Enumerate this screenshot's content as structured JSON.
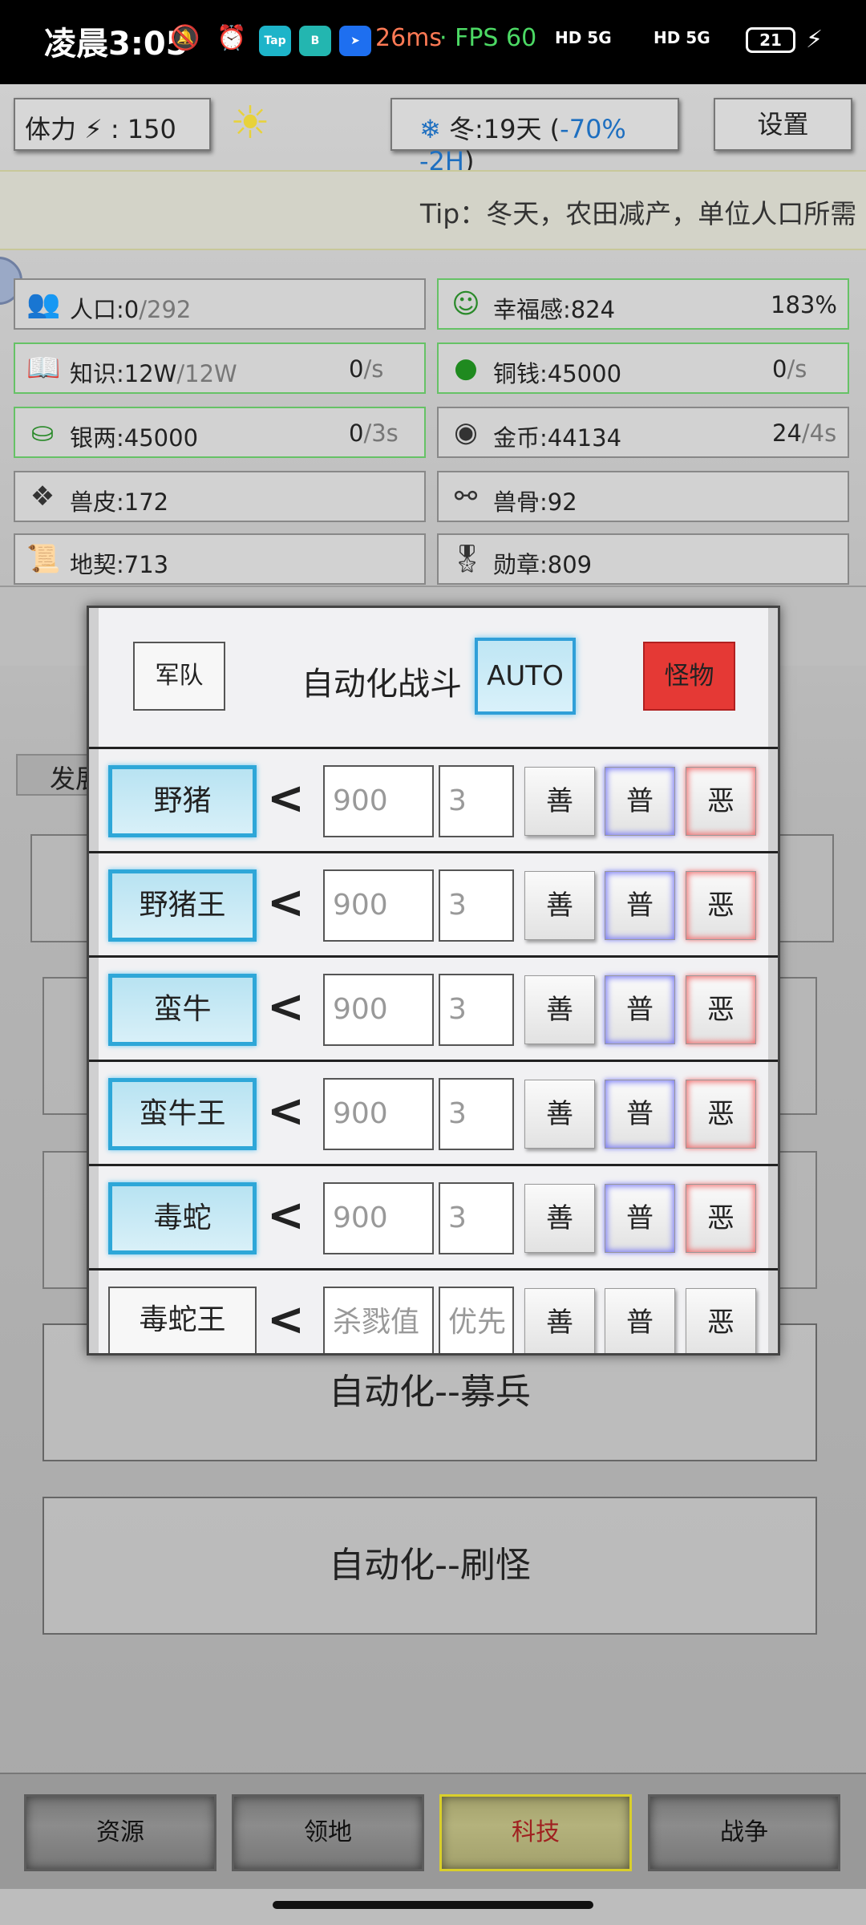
{
  "status_bar": {
    "time": "凌晨3:05",
    "latency": "26ms",
    "fps": "· FPS 60",
    "network1": "HD 5G",
    "network2": "HD 5G",
    "battery": "21"
  },
  "top": {
    "stamina_label": "体力",
    "stamina_value": ": 150",
    "season_main": "冬:19天 (",
    "season_effect": "-70% -2H",
    "season_close": ")",
    "settings": "设置"
  },
  "tip": "Tip：冬天，农田减产，单位人口所需",
  "stats": {
    "population": {
      "label": "人口:0",
      "max": "/292"
    },
    "happiness": {
      "label": "幸福感:824",
      "rate": "183%"
    },
    "knowledge": {
      "label": "知识:12W",
      "max": "/12W",
      "rate": "0",
      "unit": "/s"
    },
    "copper": {
      "label": "铜钱:45000",
      "rate": "0",
      "unit": "/s"
    },
    "silver": {
      "label": "银两:45000",
      "rate": "0",
      "unit": "/3s"
    },
    "gold": {
      "label": "金币:44134",
      "rate": "24",
      "unit": "/4s"
    },
    "hide": {
      "label": "兽皮:172"
    },
    "bone": {
      "label": "兽骨:92"
    },
    "deed": {
      "label": "地契:713"
    },
    "medal": {
      "label": "勋章:809"
    }
  },
  "background": {
    "develop_tab": "发展",
    "recruit_button": "自动化--募兵",
    "farm_button": "自动化--刷怪"
  },
  "dialog": {
    "army_button": "军队",
    "title": "自动化战斗",
    "auto_button": "AUTO",
    "monster_button": "怪物",
    "lt": "<",
    "good": "善",
    "normal": "普",
    "evil": "恶",
    "rows": [
      {
        "name": "野猪",
        "kill_value": "900",
        "priority": "3"
      },
      {
        "name": "野猪王",
        "kill_value": "900",
        "priority": "3"
      },
      {
        "name": "蛮牛",
        "kill_value": "900",
        "priority": "3"
      },
      {
        "name": "蛮牛王",
        "kill_value": "900",
        "priority": "3"
      },
      {
        "name": "毒蛇",
        "kill_value": "900",
        "priority": "3"
      },
      {
        "name": "毒蛇王",
        "kill_value_placeholder": "杀戮值",
        "priority_placeholder": "优先"
      }
    ]
  },
  "bottom_nav": {
    "resources": "资源",
    "territory": "领地",
    "technology": "科技",
    "war": "战争",
    "active_color": "#d9cf2b"
  }
}
